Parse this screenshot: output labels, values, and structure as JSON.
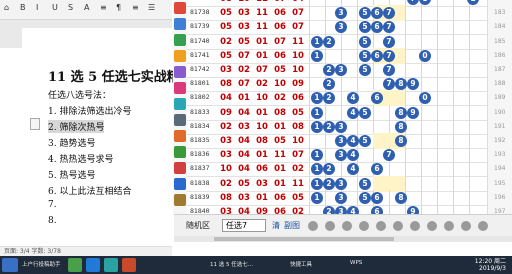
{
  "word": {
    "ribbon_items": [
      "⌂",
      "B",
      "I",
      "U",
      "S",
      "A",
      "≡",
      "¶",
      "≡",
      "☰"
    ],
    "title": "11 选 5 任选七实战精",
    "lines": [
      "任选八选号法：",
      "1. 排除法筛选出冷号",
      "2. 筛除次热号",
      "3. 趋势选号",
      "4. 热热选号求号",
      "5. 热号选号",
      "6. 以上此法互相结合",
      "7.",
      "8."
    ],
    "status": "页面: 3/4  字数: 3/78"
  },
  "lottery": {
    "rows": [
      {
        "issue": "81737",
        "nums": [
          "08",
          "10",
          "11",
          "07",
          "04"
        ],
        "balls": [
          {
            "n": "7",
            "c": 9
          },
          {
            "n": "8",
            "c": 10
          },
          {
            "n": "1",
            "c": 14
          }
        ]
      },
      {
        "issue": "81738",
        "nums": [
          "05",
          "03",
          "11",
          "06",
          "07"
        ],
        "balls": [
          {
            "n": "3",
            "c": 3
          },
          {
            "n": "5",
            "c": 5
          },
          {
            "n": "6",
            "c": 6
          },
          {
            "n": "7",
            "c": 7
          }
        ]
      },
      {
        "issue": "81739",
        "nums": [
          "05",
          "03",
          "11",
          "06",
          "07"
        ],
        "balls": [
          {
            "n": "3",
            "c": 3
          },
          {
            "n": "5",
            "c": 5
          },
          {
            "n": "6",
            "c": 6
          },
          {
            "n": "7",
            "c": 7
          }
        ]
      },
      {
        "issue": "81740",
        "nums": [
          "02",
          "05",
          "01",
          "07",
          "11"
        ],
        "balls": [
          {
            "n": "1",
            "c": 1
          },
          {
            "n": "2",
            "c": 2
          },
          {
            "n": "5",
            "c": 5
          },
          {
            "n": "7",
            "c": 7
          }
        ]
      },
      {
        "issue": "81741",
        "nums": [
          "05",
          "07",
          "01",
          "06",
          "10"
        ],
        "balls": [
          {
            "n": "1",
            "c": 1
          },
          {
            "n": "5",
            "c": 5
          },
          {
            "n": "6",
            "c": 6
          },
          {
            "n": "7",
            "c": 7
          },
          {
            "n": "0",
            "c": 10
          }
        ]
      },
      {
        "issue": "81742",
        "nums": [
          "03",
          "02",
          "07",
          "05",
          "10"
        ],
        "balls": [
          {
            "n": "2",
            "c": 2
          },
          {
            "n": "3",
            "c": 3
          },
          {
            "n": "5",
            "c": 5
          },
          {
            "n": "7",
            "c": 7
          }
        ]
      },
      {
        "issue": "81801",
        "nums": [
          "08",
          "07",
          "02",
          "10",
          "09"
        ],
        "balls": [
          {
            "n": "2",
            "c": 2
          },
          {
            "n": "7",
            "c": 7
          },
          {
            "n": "8",
            "c": 8
          },
          {
            "n": "9",
            "c": 9
          }
        ]
      },
      {
        "issue": "81802",
        "nums": [
          "04",
          "01",
          "10",
          "02",
          "06"
        ],
        "balls": [
          {
            "n": "1",
            "c": 1
          },
          {
            "n": "2",
            "c": 2
          },
          {
            "n": "4",
            "c": 4
          },
          {
            "n": "6",
            "c": 6
          },
          {
            "n": "0",
            "c": 10
          }
        ]
      },
      {
        "issue": "81833",
        "nums": [
          "09",
          "04",
          "01",
          "08",
          "05"
        ],
        "balls": [
          {
            "n": "1",
            "c": 1
          },
          {
            "n": "4",
            "c": 4
          },
          {
            "n": "5",
            "c": 5
          },
          {
            "n": "8",
            "c": 8
          },
          {
            "n": "9",
            "c": 9
          }
        ]
      },
      {
        "issue": "81834",
        "nums": [
          "02",
          "03",
          "10",
          "01",
          "08"
        ],
        "balls": [
          {
            "n": "1",
            "c": 1
          },
          {
            "n": "2",
            "c": 2
          },
          {
            "n": "3",
            "c": 3
          },
          {
            "n": "8",
            "c": 8
          }
        ]
      },
      {
        "issue": "81835",
        "nums": [
          "03",
          "04",
          "08",
          "05",
          "10"
        ],
        "balls": [
          {
            "n": "3",
            "c": 3
          },
          {
            "n": "4",
            "c": 4
          },
          {
            "n": "5",
            "c": 5
          },
          {
            "n": "8",
            "c": 8
          }
        ]
      },
      {
        "issue": "81836",
        "nums": [
          "03",
          "04",
          "01",
          "11",
          "07"
        ],
        "balls": [
          {
            "n": "1",
            "c": 1
          },
          {
            "n": "3",
            "c": 3
          },
          {
            "n": "4",
            "c": 4
          },
          {
            "n": "7",
            "c": 7
          }
        ]
      },
      {
        "issue": "81837",
        "nums": [
          "10",
          "04",
          "06",
          "01",
          "02"
        ],
        "balls": [
          {
            "n": "1",
            "c": 1
          },
          {
            "n": "2",
            "c": 2
          },
          {
            "n": "4",
            "c": 4
          },
          {
            "n": "6",
            "c": 6
          }
        ]
      },
      {
        "issue": "81838",
        "nums": [
          "02",
          "05",
          "03",
          "01",
          "11"
        ],
        "balls": [
          {
            "n": "1",
            "c": 1
          },
          {
            "n": "2",
            "c": 2
          },
          {
            "n": "3",
            "c": 3
          },
          {
            "n": "5",
            "c": 5
          }
        ]
      },
      {
        "issue": "81839",
        "nums": [
          "08",
          "03",
          "01",
          "06",
          "05"
        ],
        "balls": [
          {
            "n": "1",
            "c": 1
          },
          {
            "n": "3",
            "c": 3
          },
          {
            "n": "5",
            "c": 5
          },
          {
            "n": "6",
            "c": 6
          },
          {
            "n": "8",
            "c": 8
          }
        ]
      },
      {
        "issue": "81840",
        "nums": [
          "03",
          "04",
          "09",
          "06",
          "02"
        ],
        "balls": [
          {
            "n": "2",
            "c": 2
          },
          {
            "n": "3",
            "c": 3
          },
          {
            "n": "4",
            "c": 4
          },
          {
            "n": "6",
            "c": 6
          },
          {
            "n": "9",
            "c": 9
          }
        ]
      }
    ],
    "tail_labels": [
      "182",
      "183",
      "184",
      "185",
      "186",
      "187",
      "188",
      "189",
      "190",
      "191",
      "192",
      "193",
      "194",
      "195",
      "196",
      "197"
    ]
  },
  "bottom": {
    "label1": "随机区",
    "select": "任选7",
    "clear": "清",
    "bet": "副图"
  },
  "taskbar": {
    "items": [
      "上户行投稿助手",
      "11 选 5 任选七...",
      "快捷工具",
      "WPS"
    ],
    "time": "12:20 周二",
    "date": "2019/9/3"
  }
}
